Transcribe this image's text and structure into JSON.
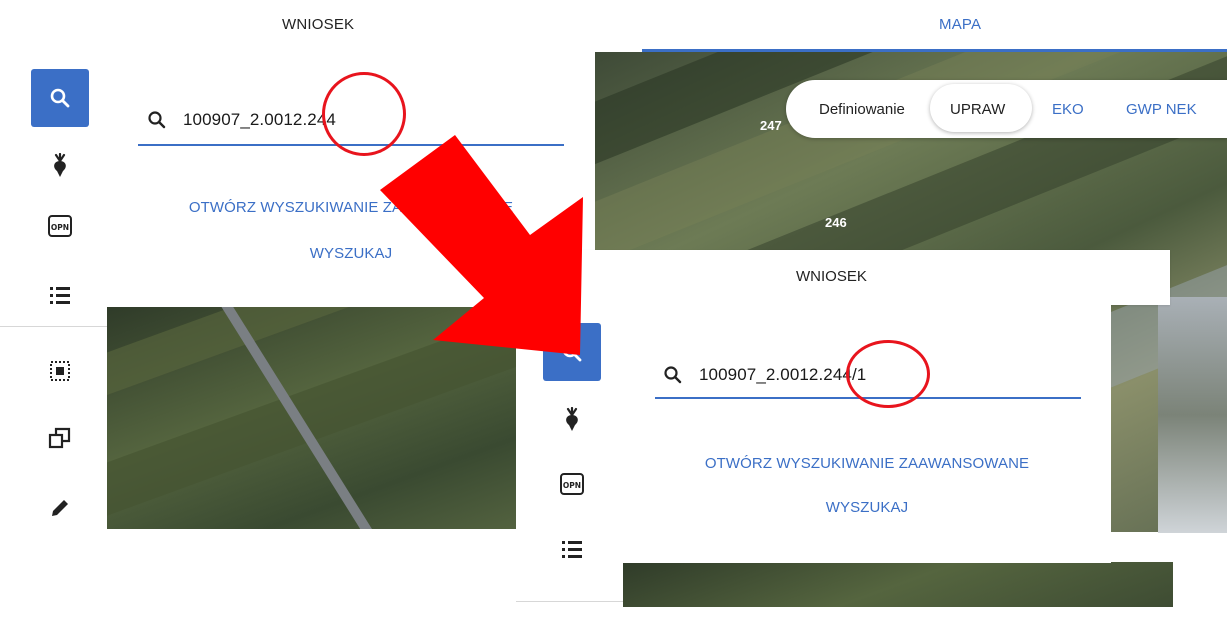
{
  "tabs": {
    "wniosek": "WNIOSEK",
    "mapa": "MAPA"
  },
  "panel_top": {
    "search_value": "100907_2.0012.244",
    "advanced_link": "OTWÓRZ WYSZUKIWANIE ZAAWANSOWANE",
    "search_link": "WYSZUKAJ"
  },
  "map_toolbar": {
    "definiowanie": "Definiowanie",
    "upraw": "UPRAW",
    "eko": "EKO",
    "gwp_nek": "GWP NEK"
  },
  "parcel_labels": {
    "p247": "247",
    "p246": "246"
  },
  "panel_bottom": {
    "tab": "WNIOSEK",
    "search_value": "100907_2.0012.244/1",
    "advanced_link": "OTWÓRZ WYSZUKIWANIE ZAAWANSOWANE",
    "search_link": "WYSZUKAJ"
  },
  "sidebar_icons": [
    "search-icon",
    "crop-icon",
    "opn-icon",
    "list-icon",
    "select-area-icon",
    "copy-icon",
    "edit-icon"
  ],
  "colors": {
    "accent": "#3b6fc6",
    "annotation": "#e8141d"
  }
}
